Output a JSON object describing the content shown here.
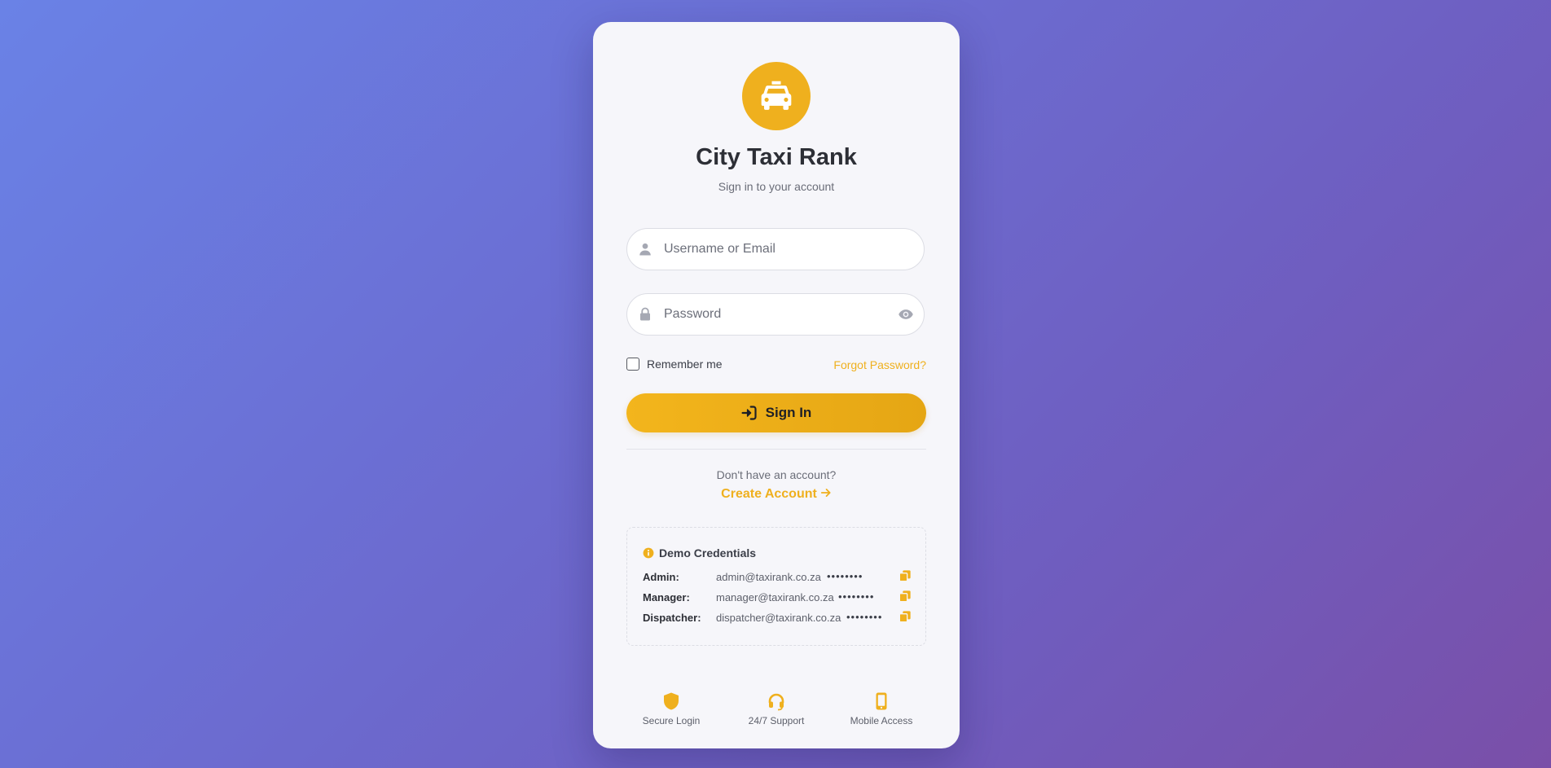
{
  "app": {
    "title": "City Taxi Rank",
    "subtitle": "Sign in to your account"
  },
  "form": {
    "username_placeholder": "Username or Email",
    "password_placeholder": "Password",
    "remember_label": "Remember me",
    "forgot_label": "Forgot Password?",
    "signin_label": "Sign In"
  },
  "register": {
    "prompt": "Don't have an account?",
    "link_label": "Create Account"
  },
  "demo": {
    "title": "Demo Credentials",
    "rows": [
      {
        "role": "Admin:",
        "email": "admin@taxirank.co.za",
        "password": "••••••••"
      },
      {
        "role": "Manager:",
        "email": "manager@taxirank.co.za",
        "password": "••••••••"
      },
      {
        "role": "Dispatcher:",
        "email": "dispatcher@taxirank.co.za",
        "password": "••••••••"
      }
    ]
  },
  "features": [
    {
      "label": "Secure Login",
      "icon": "shield-icon"
    },
    {
      "label": "24/7 Support",
      "icon": "headset-icon"
    },
    {
      "label": "Mobile Access",
      "icon": "mobile-icon"
    }
  ],
  "colors": {
    "accent": "#efb01e",
    "card_bg": "#f6f6fa",
    "bg_gradient_start": "#6a82e6",
    "bg_gradient_end": "#7a4fa8"
  }
}
